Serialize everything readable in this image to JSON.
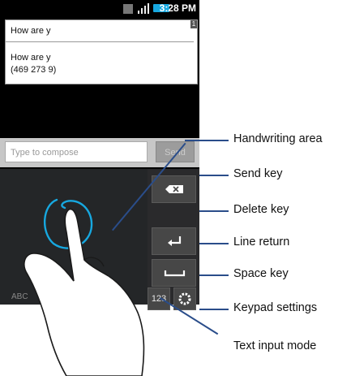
{
  "statusbar": {
    "time": "3:28 PM"
  },
  "suggestions": {
    "input_text": "How are y",
    "badge": "1",
    "contact_name": "How are y",
    "contact_number": "(469 273 9)"
  },
  "compose": {
    "placeholder": "Type to compose",
    "send_label": "Send"
  },
  "keypad": {
    "mode_label": "123",
    "abc_label": "ABC"
  },
  "callouts": {
    "handwriting": "Handwriting area",
    "send": "Send key",
    "delete": "Delete key",
    "line_return": "Line return",
    "space": "Space key",
    "settings": "Keypad settings",
    "input_mode": "Text input mode"
  },
  "colors": {
    "callout_line": "#2a4d8a",
    "stroke": "#17a8e0",
    "battery": "#17a8e0"
  }
}
